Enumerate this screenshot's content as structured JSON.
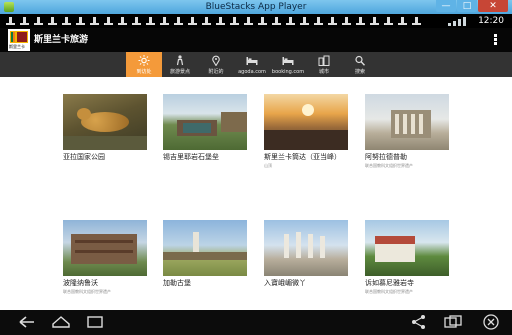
{
  "window": {
    "title": "BlueStacks App Player",
    "min": "—",
    "max": "□",
    "close": "✕"
  },
  "statusbar": {
    "time": "12:20"
  },
  "app": {
    "title": "斯里兰卡旅游",
    "flag_caption": "斯里兰卡"
  },
  "tabs": [
    {
      "label": "到访处",
      "icon": "sun-icon",
      "active": true
    },
    {
      "label": "旅游景点",
      "icon": "person-icon",
      "active": false
    },
    {
      "label": "附近的",
      "icon": "location-icon",
      "active": false
    },
    {
      "label": "agoda.com",
      "icon": "bed-icon",
      "active": false
    },
    {
      "label": "booking.com",
      "icon": "bed-icon",
      "active": false
    },
    {
      "label": "城市",
      "icon": "buildings-icon",
      "active": false
    },
    {
      "label": "搜索",
      "icon": "search-icon",
      "active": false
    }
  ],
  "places": [
    {
      "name": "亚拉国家公园",
      "sub": ""
    },
    {
      "name": "锡吉里耶岩石堡垒",
      "sub": ""
    },
    {
      "name": "斯里兰卡筒达（亚当峰）",
      "sub": "山顶"
    },
    {
      "name": "阿努拉德普勒",
      "sub": "联合国教科文组织世界遗产"
    },
    {
      "name": "波隆纳鲁沃",
      "sub": "联合国教科文组织世界遗产"
    },
    {
      "name": "加勒古堡",
      "sub": ""
    },
    {
      "name": "入寶峨嵋微丫",
      "sub": ""
    },
    {
      "name": "诉如慕尼雅岩寺",
      "sub": "联合国教科文组织世界遗产"
    }
  ],
  "colors": {
    "accent": "#f49a3a",
    "tabbar": "#333333",
    "actionbar": "#060606"
  }
}
